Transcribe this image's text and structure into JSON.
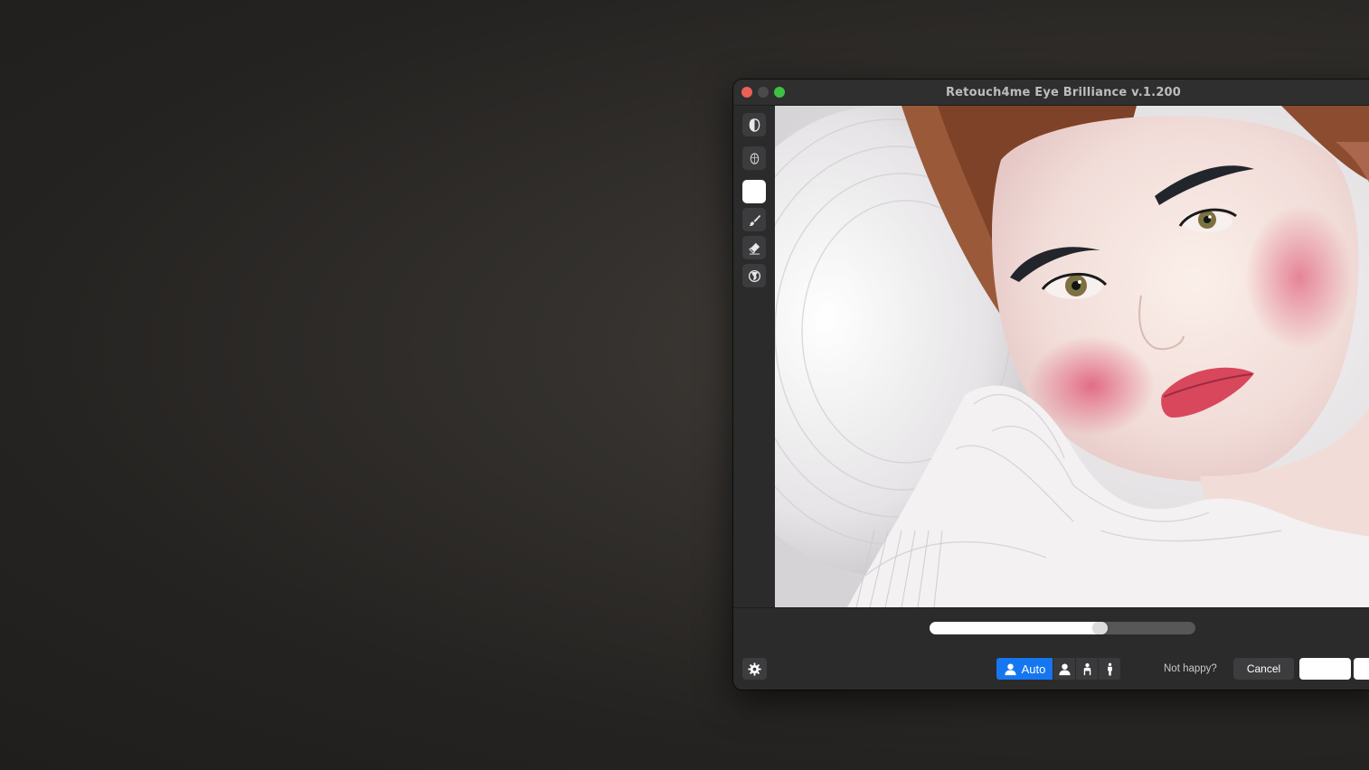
{
  "window": {
    "title": "Retouch4me Eye Brilliance v.1.200"
  },
  "toolbar": {
    "tools": [
      "mask-icon",
      "face-icon",
      "color-swatch",
      "brush-icon",
      "eraser-icon",
      "globe-icon"
    ]
  },
  "slider": {
    "value_fraction": 0.67
  },
  "bottom": {
    "modes": {
      "auto_label": "Auto"
    },
    "not_happy_label": "Not happy?",
    "cancel_label": "Cancel"
  },
  "colors": {
    "accent": "#1577f0",
    "close": "#ee5f57",
    "maximize": "#3fc044"
  }
}
